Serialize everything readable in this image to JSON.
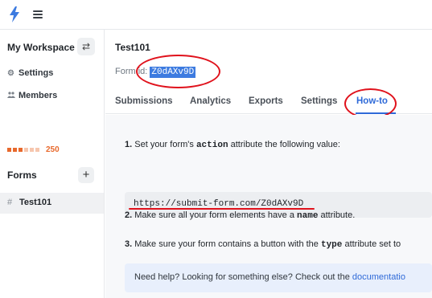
{
  "header": {
    "logo_icon": "bolt-icon",
    "menu_icon": "hamburger-icon",
    "accent_color": "#3d7be0"
  },
  "sidebar": {
    "workspace_title": "My Workspace",
    "switch_icon": "switch-arrows-icon",
    "links": [
      {
        "label": "Settings",
        "icon": "gear-icon"
      },
      {
        "label": "Members",
        "icon": "users-icon"
      }
    ],
    "usage": {
      "count": "250",
      "segments_filled": 3,
      "segments_total": 6,
      "color": "#e8692c"
    },
    "forms_title": "Forms",
    "add_icon": "plus-icon",
    "form_items": [
      {
        "hash": "#",
        "label": "Test101"
      }
    ]
  },
  "main": {
    "form_title": "Test101",
    "form_id_label": "Form id:",
    "form_id_value": "Z0dAXv9D",
    "tabs": [
      {
        "label": "Submissions",
        "active": false
      },
      {
        "label": "Analytics",
        "active": false
      },
      {
        "label": "Exports",
        "active": false
      },
      {
        "label": "Settings",
        "active": false
      },
      {
        "label": "How-to",
        "active": true
      }
    ],
    "steps": [
      {
        "num": "1.",
        "before": "Set your form's ",
        "code": "action",
        "after": " attribute the following value:"
      },
      {
        "num": "2.",
        "before": "Make sure all your form elements have a ",
        "code": "name",
        "after": " attribute."
      },
      {
        "num": "3.",
        "before": "Make sure your form contains a button with the ",
        "code": "type",
        "after": " attribute set to"
      }
    ],
    "action_url": "https://submit-form.com/Z0dAXv9D",
    "help": {
      "text": "Need help? Looking for something else? Check out the ",
      "link": "documentatio"
    }
  },
  "annotation_color": "#e0121c"
}
